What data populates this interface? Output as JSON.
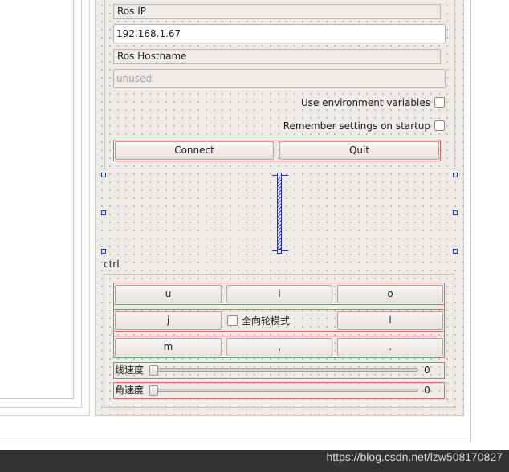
{
  "form": {
    "ros_ip_label": "Ros IP",
    "ros_ip_value": "192.168.1.67",
    "ros_hostname_label": "Ros Hostname",
    "ros_hostname_placeholder": "unused",
    "use_env_label": "Use environment variables",
    "use_env_checked": false,
    "remember_label": "Remember settings on startup",
    "remember_checked": false,
    "connect_label": "Connect",
    "quit_label": "Quit"
  },
  "ctrl": {
    "group_label": "ctrl",
    "keys_row1": [
      "u",
      "i",
      "o"
    ],
    "key_j": "j",
    "key_l": "l",
    "omni_label": "全向轮模式",
    "omni_checked": false,
    "keys_row3": [
      "m",
      ",",
      "."
    ],
    "linear_label": "线速度",
    "linear_value": "0",
    "angular_label": "角速度",
    "angular_value": "0"
  },
  "watermark": "https://blog.csdn.net/lzw508170827",
  "colors": {
    "panel_bg": "#efebe7",
    "highlight_border": "#e06a6a",
    "designer_handle": "#2233bb",
    "status_bg": "#333333"
  }
}
